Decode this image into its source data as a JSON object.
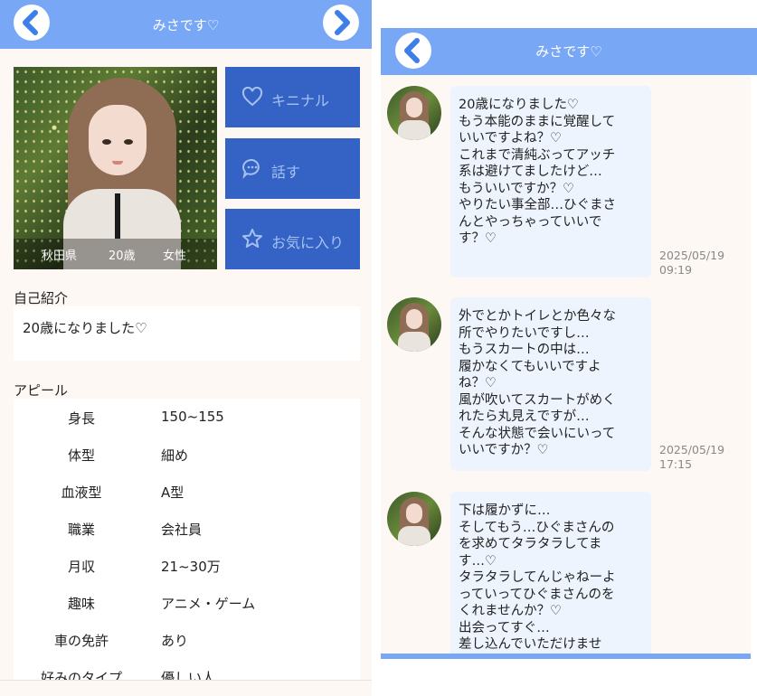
{
  "profile": {
    "header_title": "みさです♡",
    "location": "秋田県",
    "age": "20歳",
    "gender": "女性",
    "actions": {
      "like": "キニナル",
      "talk": "話す",
      "favorite": "お気に入り"
    },
    "intro_heading": "自己紹介",
    "intro_text": "20歳になりました♡",
    "appeal_heading": "アピール",
    "appeal": [
      {
        "key": "身長",
        "value": "150~155"
      },
      {
        "key": "体型",
        "value": "細め"
      },
      {
        "key": "血液型",
        "value": "A型"
      },
      {
        "key": "職業",
        "value": "会社員"
      },
      {
        "key": "月収",
        "value": "21~30万"
      },
      {
        "key": "趣味",
        "value": "アニメ・ゲーム"
      },
      {
        "key": "車の免許",
        "value": "あり"
      },
      {
        "key": "好みのタイプ",
        "value": "優しい人"
      }
    ]
  },
  "chat": {
    "header_title": "みさです♡",
    "messages": [
      {
        "text": "20歳になりました♡\nもう本能のままに覚醒して\nいいですよね？♡\nこれまで清純ぶってアッチ\n系は避けてましたけど…\nもういいですか？♡\nやりたい事全部…ひぐまさ\nんとやっちゃっていいで\nす？♡",
        "time": "2025/05/19\n09:19"
      },
      {
        "text": "外でとかトイレとか色々な\n所でやりたいですし…\nもうスカートの中は…\n履かなくてもいいですよ\nね？♡\n風が吹いてスカートがめく\nれたら丸見えですが…\nそんな状態で会いにいって\nいいですか？♡",
        "time": "2025/05/19\n17:15"
      },
      {
        "text": "下は履かずに…\nそしてもう…ひぐまさんの\nを求めてタラタラしてま\nす…♡\nタラタラしてんじゃねーよ\nっていってひぐまさんのを\nくれませんか？♡\n出会ってすぐ…\n差し込んでいただけませ",
        "time": ""
      }
    ]
  },
  "colors": {
    "header": "#78a8f5",
    "action_button": "#3563c5",
    "bubble": "#edf4fe",
    "background": "#fdf8f4"
  }
}
